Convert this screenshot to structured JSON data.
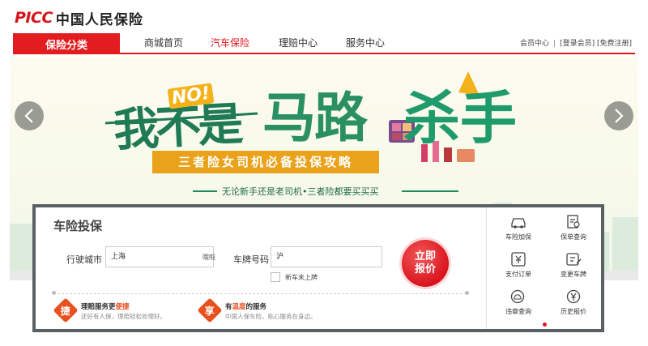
{
  "brand": {
    "mark": "PICC",
    "name": "中国人民保险"
  },
  "nav": {
    "category_label": "保险分类",
    "items": [
      "商城首页",
      "汽车保险",
      "理赔中心",
      "服务中心"
    ],
    "active_index": 1,
    "member_center": "会员中心",
    "separator": "|",
    "login": "[登录会员]",
    "register": "[免费注册]"
  },
  "banner": {
    "headline_part1": "我不是",
    "headline_no": "NO!",
    "headline_part2": "马路",
    "headline_part3": "杀手",
    "subtitle": "三者险女司机必备投保攻略",
    "tagline": "无论新手还是老司机•三者险都要买买买",
    "prev_icon": "chevron-left-icon",
    "next_icon": "chevron-right-icon"
  },
  "quote": {
    "title": "车险投保",
    "city_label": "行驶城市",
    "city_value": "上海",
    "city_tag": "哦啦",
    "plate_label": "车牌号码",
    "plate_value": "沪",
    "new_car_label": "新车未上牌",
    "button_line1": "立即",
    "button_line2": "报价",
    "features": [
      {
        "badge": "捷",
        "title_prefix": "理赔服务更",
        "title_highlight": "便捷",
        "desc": "还好有人保，理赔轻松处理好。"
      },
      {
        "badge": "享",
        "title_prefix": "有",
        "title_highlight": "温度",
        "title_suffix": "的服务",
        "desc": "中国人保车险，贴心服务在身边。"
      }
    ]
  },
  "side_menu": [
    {
      "label": "车险加保",
      "icon": "car-icon"
    },
    {
      "label": "保单查询",
      "icon": "policy-search-icon"
    },
    {
      "label": "支付订单",
      "icon": "payment-icon"
    },
    {
      "label": "变更车牌",
      "icon": "plate-change-icon"
    },
    {
      "label": "违章查询",
      "icon": "violation-search-icon"
    },
    {
      "label": "历史报价",
      "icon": "history-price-icon"
    }
  ],
  "colors": {
    "brand_red": "#e31d1f",
    "headline_green": "#1f7a55",
    "subtitle_orange": "#eaa21a"
  }
}
